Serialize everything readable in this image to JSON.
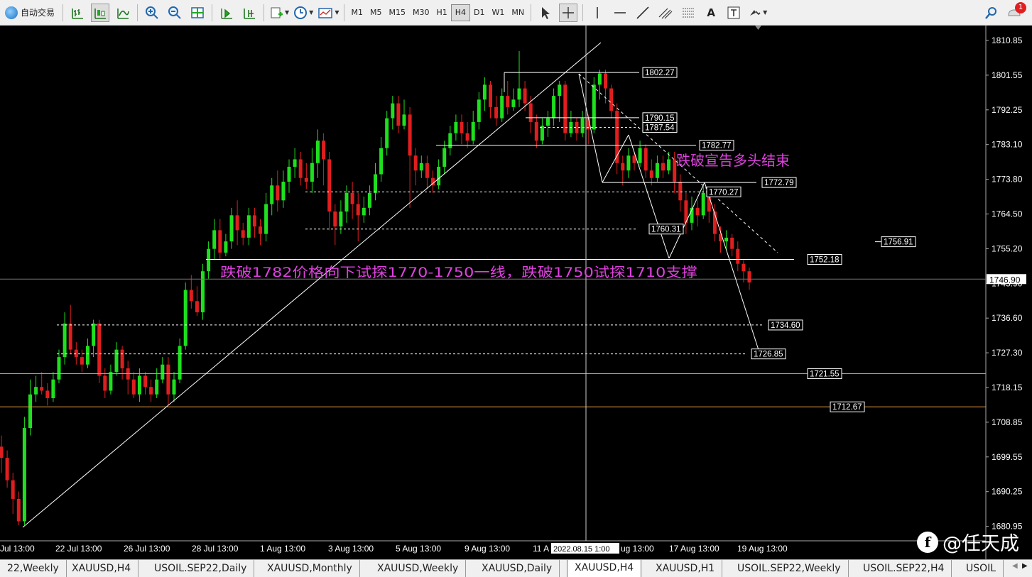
{
  "toolbar": {
    "autotrade_label": "自动交易",
    "timeframes": [
      "M1",
      "M5",
      "M15",
      "M30",
      "H1",
      "H4",
      "D1",
      "W1",
      "MN"
    ],
    "active_timeframe": "H4",
    "text_tool": "A",
    "alerts_badge": "1"
  },
  "chart": {
    "symbol": "XAUUSD,H4",
    "type": "candlestick",
    "price_axis": [
      "1810.85",
      "1801.55",
      "1792.25",
      "1783.10",
      "1773.80",
      "1764.50",
      "1755.20",
      "1745.90",
      "1736.60",
      "1727.30",
      "1718.15",
      "1708.85",
      "1699.55",
      "1690.25",
      "1680.95"
    ],
    "current_price": "1746.90",
    "time_axis": [
      "Jul 13:00",
      "22 Jul 13:00",
      "26 Jul 13:00",
      "28 Jul 13:00",
      "1 Aug 13:00",
      "3 Aug 13:00",
      "5 Aug 13:00",
      "9 Aug 13:00",
      "11 A",
      "ug 13:00",
      "17 Aug 13:00",
      "19 Aug 13:00"
    ],
    "crosshair_label": "2022.08.15 1:00",
    "levels": [
      "1802.27",
      "1790.15",
      "1787.54",
      "1782.77",
      "1772.79",
      "1770.27",
      "1760.31",
      "1756.91",
      "1752.18",
      "1734.60",
      "1726.85",
      "1721.55",
      "1712.67"
    ],
    "annotation_main": "跌破1782价格向下试探1770-1750一线，跌破1750试探1710支撑",
    "annotation_top": "跌破宣告多头结束",
    "colors": {
      "up": "#1ee01e",
      "down": "#e01e1e",
      "text_annot": "#e040e0",
      "level_orange": "#e8a040",
      "bg": "#000000"
    }
  },
  "tabs": [
    "22,Weekly",
    "XAUUSD,H4",
    "USOIL.SEP22,Daily",
    "XAUUSD,Monthly",
    "XAUUSD,Weekly",
    "XAUUSD,Daily",
    "XAUUSD,H4",
    "XAUUSD,H1",
    "USOIL.SEP22,Weekly",
    "USOIL.SEP22,H4",
    "USOIL"
  ],
  "active_tab": "XAUUSD,H4",
  "watermark": "@任天成"
}
